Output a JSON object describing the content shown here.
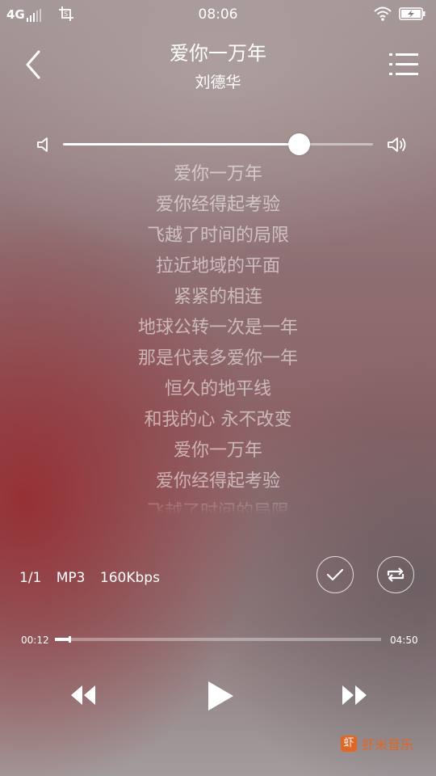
{
  "status_bar": {
    "network": "4G",
    "time": "08:06"
  },
  "header": {
    "title": "爱你一万年",
    "artist": "刘德华",
    "back_icon": "chevron-left-icon",
    "menu_icon": "playlist-icon"
  },
  "volume": {
    "level": 0.76,
    "low_icon": "volume-low-icon",
    "high_icon": "volume-high-icon"
  },
  "lyrics": [
    "爱你一万年",
    "爱你经得起考验",
    "飞越了时间的局限",
    "拉近地域的平面",
    "紧紧的相连",
    "地球公转一次是一年",
    "那是代表多爱你一年",
    "恒久的地平线",
    "和我的心 永不改变",
    "爱你一万年",
    "爱你经得起考验",
    "飞越了时间的局限"
  ],
  "track_info": {
    "index": "1/1",
    "format": "MP3",
    "bitrate": "160Kbps"
  },
  "progress": {
    "current": "00:12",
    "total": "04:50",
    "fraction": 0.045
  },
  "brand": {
    "logo_char": "虾",
    "name": "虾米音乐"
  },
  "colors": {
    "accent": "#e8641c"
  }
}
